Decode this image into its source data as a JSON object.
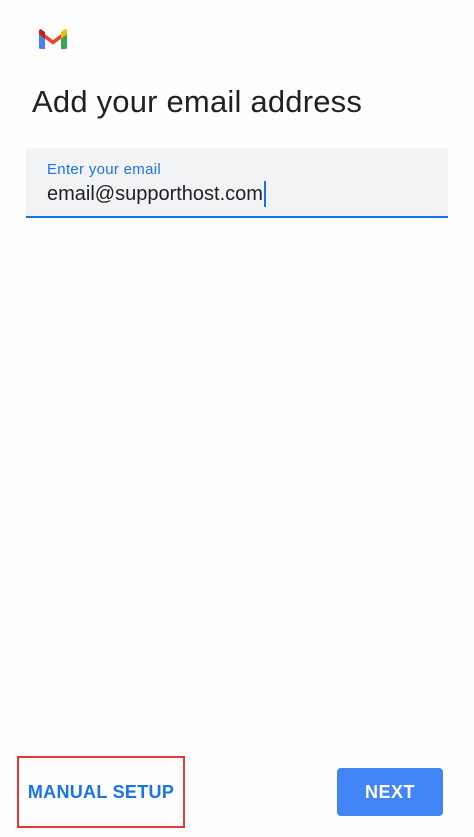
{
  "app": {
    "logo_icon": "gmail-logo-icon"
  },
  "header": {
    "title": "Add your email address"
  },
  "email_field": {
    "label": "Enter your email",
    "value": "email@supporthost.com"
  },
  "footer": {
    "manual_setup_label": "MANUAL SETUP",
    "next_label": "NEXT"
  },
  "colors": {
    "accent": "#1a73e8",
    "next_button_bg": "#4285f4",
    "highlight_box": "#e53935",
    "field_bg": "#f1f3f4"
  }
}
